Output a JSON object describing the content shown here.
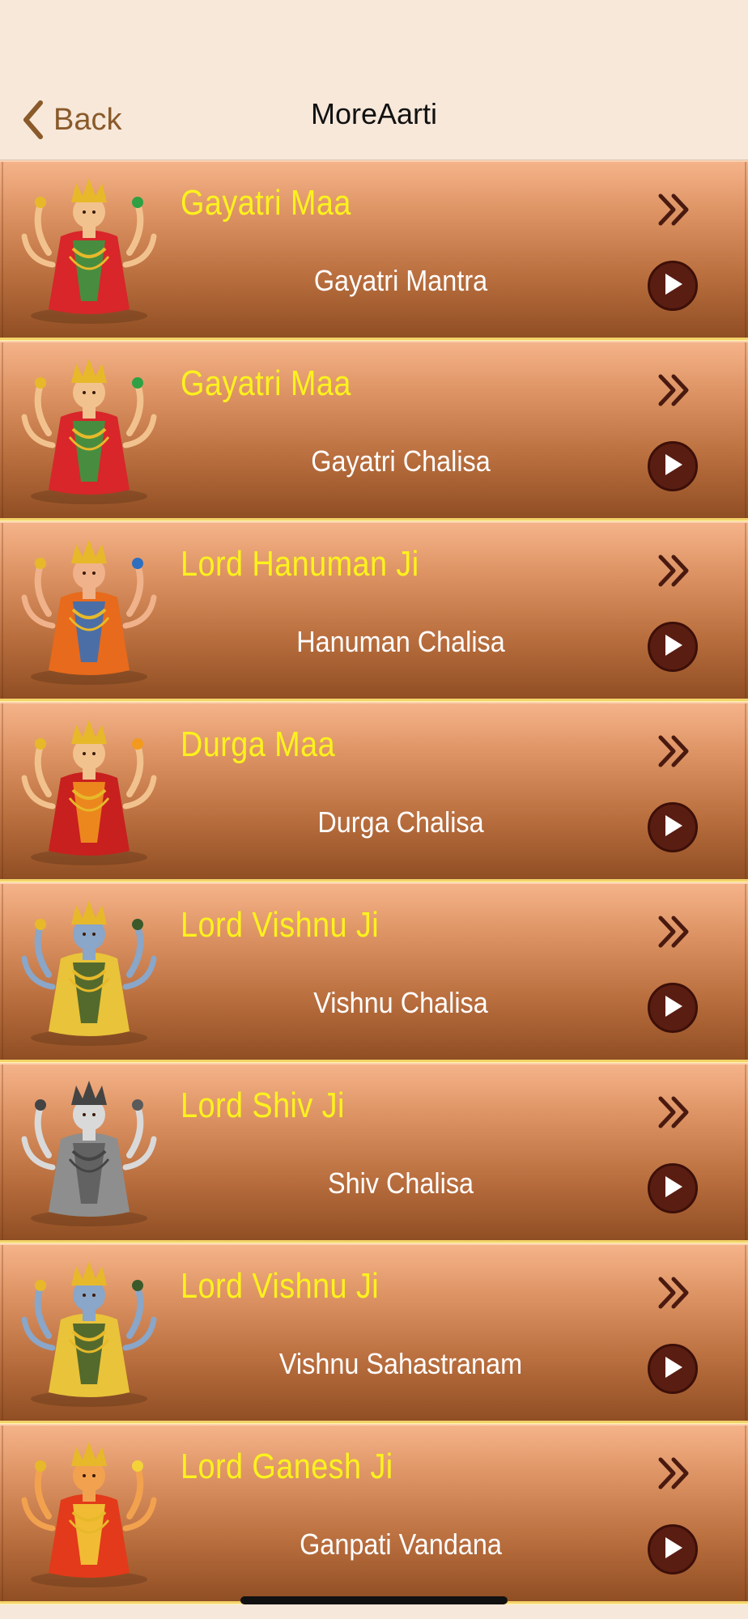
{
  "nav": {
    "back_label": "Back",
    "title": "MoreAarti"
  },
  "items": [
    {
      "deity": "Gayatri Maa",
      "title": "Gayatri Mantra",
      "image": "gayatri-maa-image"
    },
    {
      "deity": "Gayatri Maa",
      "title": "Gayatri Chalisa",
      "image": "gayatri-maa-image"
    },
    {
      "deity": "Lord Hanuman Ji",
      "title": "Hanuman Chalisa",
      "image": "hanuman-ji-image"
    },
    {
      "deity": "Durga Maa",
      "title": "Durga Chalisa",
      "image": "durga-maa-image"
    },
    {
      "deity": "Lord Vishnu Ji",
      "title": "Vishnu Chalisa",
      "image": "vishnu-ji-image"
    },
    {
      "deity": "Lord Shiv Ji",
      "title": "Shiv Chalisa",
      "image": "shiv-ji-image"
    },
    {
      "deity": "Lord Vishnu Ji",
      "title": "Vishnu Sahastranam",
      "image": "vishnu-ji-image"
    },
    {
      "deity": "Lord Ganesh Ji",
      "title": "Ganpati Vandana",
      "image": "ganesh-ji-image"
    }
  ],
  "colors": {
    "accent": "#8a5a2a",
    "deity_text": "#fdf21d",
    "title_text": "#ffffff",
    "play_bg": "#5a1d12",
    "chevron": "#4a1a10"
  },
  "icons": {
    "back": "chevron-left-icon",
    "more": "double-chevron-right-icon",
    "play": "play-icon"
  }
}
